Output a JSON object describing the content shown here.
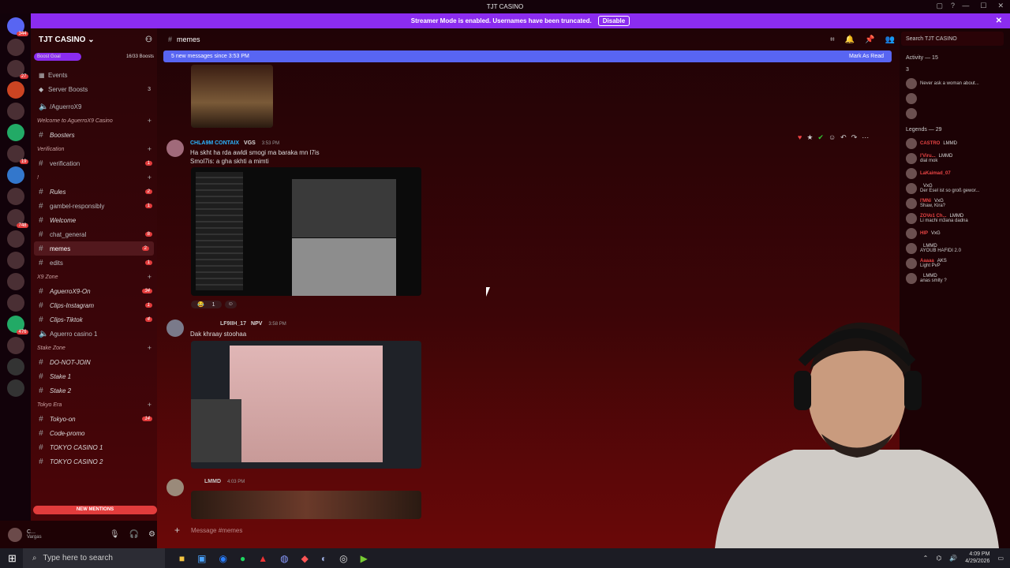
{
  "window": {
    "title": "TJT CASINO"
  },
  "banner": {
    "text": "Streamer Mode is enabled. Usernames have been truncated.",
    "button": "Disable"
  },
  "server": {
    "name": "TJT CASINO",
    "boost_goal": "Boost Goal",
    "boosts": "16/33 Boosts"
  },
  "sidebar": {
    "top": [
      {
        "label": "Events",
        "icon": "calendar-icon"
      },
      {
        "label": "Server Boosts",
        "icon": "boost-icon",
        "count": "3"
      }
    ],
    "channels": [
      {
        "type": "channel",
        "label": "/AguerroX9",
        "icon": "speaker-icon"
      },
      {
        "type": "category",
        "label": "Welcome to AguerroX9 Casino"
      },
      {
        "type": "channel",
        "label": "Boosters",
        "italic": true
      },
      {
        "type": "category",
        "label": "Verification"
      },
      {
        "type": "channel",
        "label": "verification",
        "badge": "1"
      },
      {
        "type": "category",
        "label": "!"
      },
      {
        "type": "channel",
        "label": "Rules",
        "badge": "2",
        "italic": true
      },
      {
        "type": "channel",
        "label": "gambel-responsibly",
        "badge": "1"
      },
      {
        "type": "channel",
        "label": "Welcome",
        "italic": true
      },
      {
        "type": "channel",
        "label": "chat_general",
        "badge": "8"
      },
      {
        "type": "channel",
        "label": "memes",
        "badge": "2",
        "selected": true
      },
      {
        "type": "channel",
        "label": "edits",
        "badge": "1"
      },
      {
        "type": "category",
        "label": "X9 Zone"
      },
      {
        "type": "channel",
        "label": "AguerroX9-On",
        "badge": "34",
        "italic": true
      },
      {
        "type": "channel",
        "label": "Clips-Instagram",
        "badge": "1",
        "italic": true
      },
      {
        "type": "channel",
        "label": "Clips-Tiktok",
        "badge": "4",
        "italic": true
      },
      {
        "type": "channel",
        "label": "Aguerro casino 1",
        "icon": "speaker-icon"
      },
      {
        "type": "category",
        "label": "Stake Zone"
      },
      {
        "type": "channel",
        "label": "DO-NOT-JOIN",
        "italic": true
      },
      {
        "type": "channel",
        "label": "Stake 1",
        "italic": true
      },
      {
        "type": "channel",
        "label": "Stake 2",
        "italic": true
      },
      {
        "type": "category",
        "label": "Tokyo Era"
      },
      {
        "type": "channel",
        "label": "Tokyo-on",
        "badge": "14",
        "italic": true
      },
      {
        "type": "channel",
        "label": "Code-promo",
        "italic": true
      },
      {
        "type": "channel",
        "label": "TOKYO CASINO 1",
        "italic": true
      },
      {
        "type": "channel",
        "label": "TOKYO CASINO 2",
        "italic": true
      }
    ],
    "new_mentions": "NEW MENTIONS"
  },
  "user": {
    "name": "C...",
    "status": "Vargas"
  },
  "channel_header": {
    "name": "memes"
  },
  "new_messages_bar": {
    "text": "5 new messages since 3:53 PM",
    "action": "Mark As Read"
  },
  "messages": [
    {
      "author": "CHLA9M CONTAIX",
      "tag": "VGS",
      "time": "3:53 PM",
      "lines": [
        "Ha skht ha rda awldi smogi ma baraka mn l7is",
        "Smol7is: a gha skhti a mimti"
      ],
      "reaction": {
        "emoji": "😂",
        "count": "1"
      }
    },
    {
      "author": "LF9IIH_17",
      "tag": "NPV",
      "time": "3:58 PM",
      "lines": [
        "Dak khraay stoohaa"
      ]
    },
    {
      "author": "",
      "tag": "LMMD",
      "time": "4:03 PM",
      "lines": []
    }
  ],
  "composer": {
    "placeholder": "Message #memes"
  },
  "search": {
    "placeholder": "Search TJT CASINO"
  },
  "members": {
    "activity": "Activity — 15",
    "group1": "3",
    "legends": "Legends — 29",
    "list": [
      {
        "name": "CASTRO",
        "tag": "LMMD",
        "sub": ""
      },
      {
        "name": "l'Viru...",
        "tag": "LMMD",
        "sub": "dial mok"
      },
      {
        "name": "LaKaimad_07",
        "tag": "",
        "sub": ""
      },
      {
        "name": "",
        "tag": "VxG",
        "sub": "Der Esel ist so groß gewor..."
      },
      {
        "name": "l'MNi",
        "tag": "VxG",
        "sub": "Shaw, Kira?"
      },
      {
        "name": "ZOVo1 Ch...",
        "tag": "LMMD",
        "sub": "Li machi m3ana dadna"
      },
      {
        "name": "HIP",
        "tag": "VxG",
        "sub": ""
      },
      {
        "name": "",
        "tag": "LMMD",
        "sub": "AYOUB HAFIDI 2.0"
      },
      {
        "name": "Aaaaa",
        "tag": "AKS",
        "sub": "Light PvP"
      },
      {
        "name": "",
        "tag": "LMMD",
        "sub": "anas smlty ?"
      }
    ],
    "activity_text": "Never ask a woman about..."
  },
  "taskbar": {
    "search": "Type here to search",
    "time": "4:09 PM",
    "date": "4/29/2026"
  }
}
